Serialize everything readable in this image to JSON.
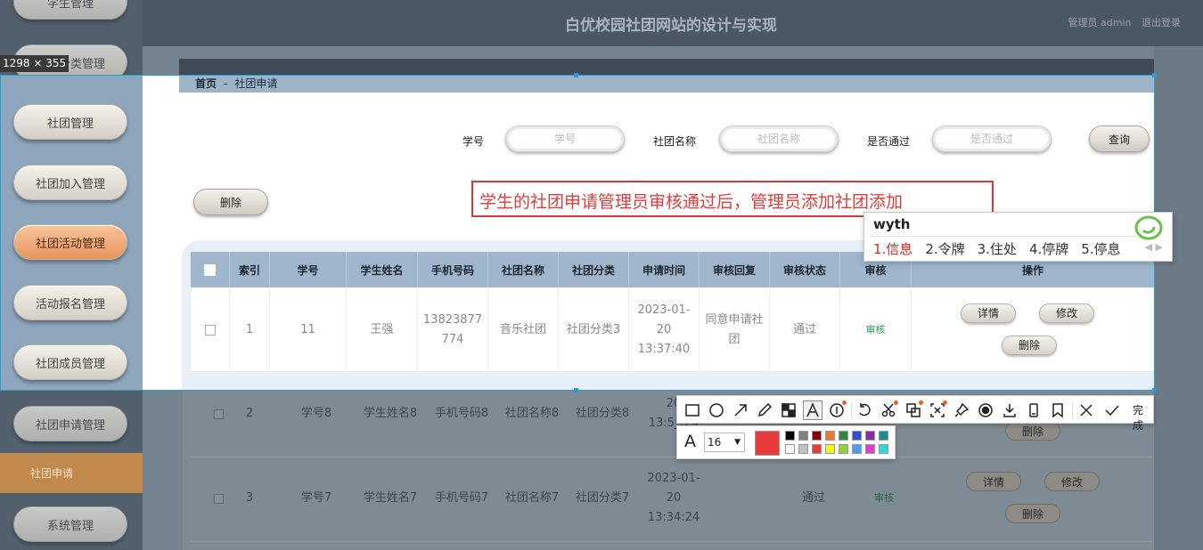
{
  "app": {
    "site_title": "白优校园社团网站的设计与实现",
    "user_label": "管理员 admin",
    "logout_label": "退出登录"
  },
  "sidebar": {
    "items": [
      {
        "label": "学生管理"
      },
      {
        "label": "社团分类管理"
      },
      {
        "label": "社团管理"
      },
      {
        "label": "社团加入管理"
      },
      {
        "label": "社团活动管理"
      },
      {
        "label": "活动报名管理"
      },
      {
        "label": "社团成员管理"
      },
      {
        "label": "社团申请管理"
      },
      {
        "label": "系统管理"
      }
    ],
    "sub_item": "社团申请"
  },
  "breadcrumb": {
    "home": "首页",
    "separator": "-",
    "current": "社团申请"
  },
  "search": {
    "fields": [
      {
        "label": "学号",
        "placeholder": "学号"
      },
      {
        "label": "社团名称",
        "placeholder": "社团名称"
      },
      {
        "label": "是否通过",
        "placeholder": "是否通过"
      }
    ],
    "query_label": "查询",
    "delete_label": "删除"
  },
  "table": {
    "headers": [
      "索引",
      "学号",
      "学生姓名",
      "手机号码",
      "社团名称",
      "社团分类",
      "申请时间",
      "审核回复",
      "审核状态",
      "审核",
      "操作"
    ],
    "rows": [
      {
        "index": "1",
        "student_no": "11",
        "name": "王强",
        "phone": "13823877774",
        "club": "音乐社团",
        "category": "社团分类3",
        "time": "2023-01-20 13:37:40",
        "reply": "同意申请社团",
        "status": "通过",
        "audit": "审核"
      },
      {
        "index": "2",
        "student_no": "学号8",
        "name": "学生姓名8",
        "phone": "手机号码8",
        "club": "社团名称8",
        "category": "社团分类8",
        "time": "2023-01-20 13:5_:24",
        "reply": "",
        "status": "",
        "audit": ""
      },
      {
        "index": "3",
        "student_no": "学号7",
        "name": "学生姓名7",
        "phone": "手机号码7",
        "club": "社团名称7",
        "category": "社团分类7",
        "time": "2023-01-20 13:34:24",
        "reply": "",
        "status": "通过",
        "audit": "审核"
      }
    ],
    "row_actions": {
      "detail": "详情",
      "edit": "修改",
      "delete": "删除"
    }
  },
  "annotation": {
    "text": "学生的社团申请管理员审核通过后，管理员添加社团添加",
    "color": "#e23c3c"
  },
  "capture": {
    "size_label": "1298 × 355",
    "border_color": "#2b9ad6"
  },
  "ime": {
    "input": "wyth",
    "candidates": [
      "1.信息",
      "2.令牌",
      "3.住处",
      "4.停牌",
      "5.停息"
    ]
  },
  "toolbar": {
    "tools": [
      "rectangle-icon",
      "ellipse-icon",
      "arrow-icon",
      "pencil-icon",
      "mosaic-icon",
      "text-icon",
      "number-icon",
      "undo-icon",
      "scissors-icon",
      "ocr-icon",
      "crop-icon",
      "pin-icon",
      "record-icon",
      "download-icon",
      "save-icon",
      "bookmark-icon",
      "close-icon",
      "check-icon"
    ],
    "done_label": "完成",
    "font_size": "16",
    "current_color": "#e83b3b",
    "palette": [
      "#000000",
      "#808080",
      "#8b0000",
      "#e87b2c",
      "#2e8b3a",
      "#2d4fd6",
      "#8b2aa8",
      "#1b8d8d",
      "#ffffff",
      "#c0c0c0",
      "#e83b3b",
      "#f5f51a",
      "#8fd13a",
      "#4aa0e8",
      "#e23cc8",
      "#2ad8d8"
    ]
  }
}
